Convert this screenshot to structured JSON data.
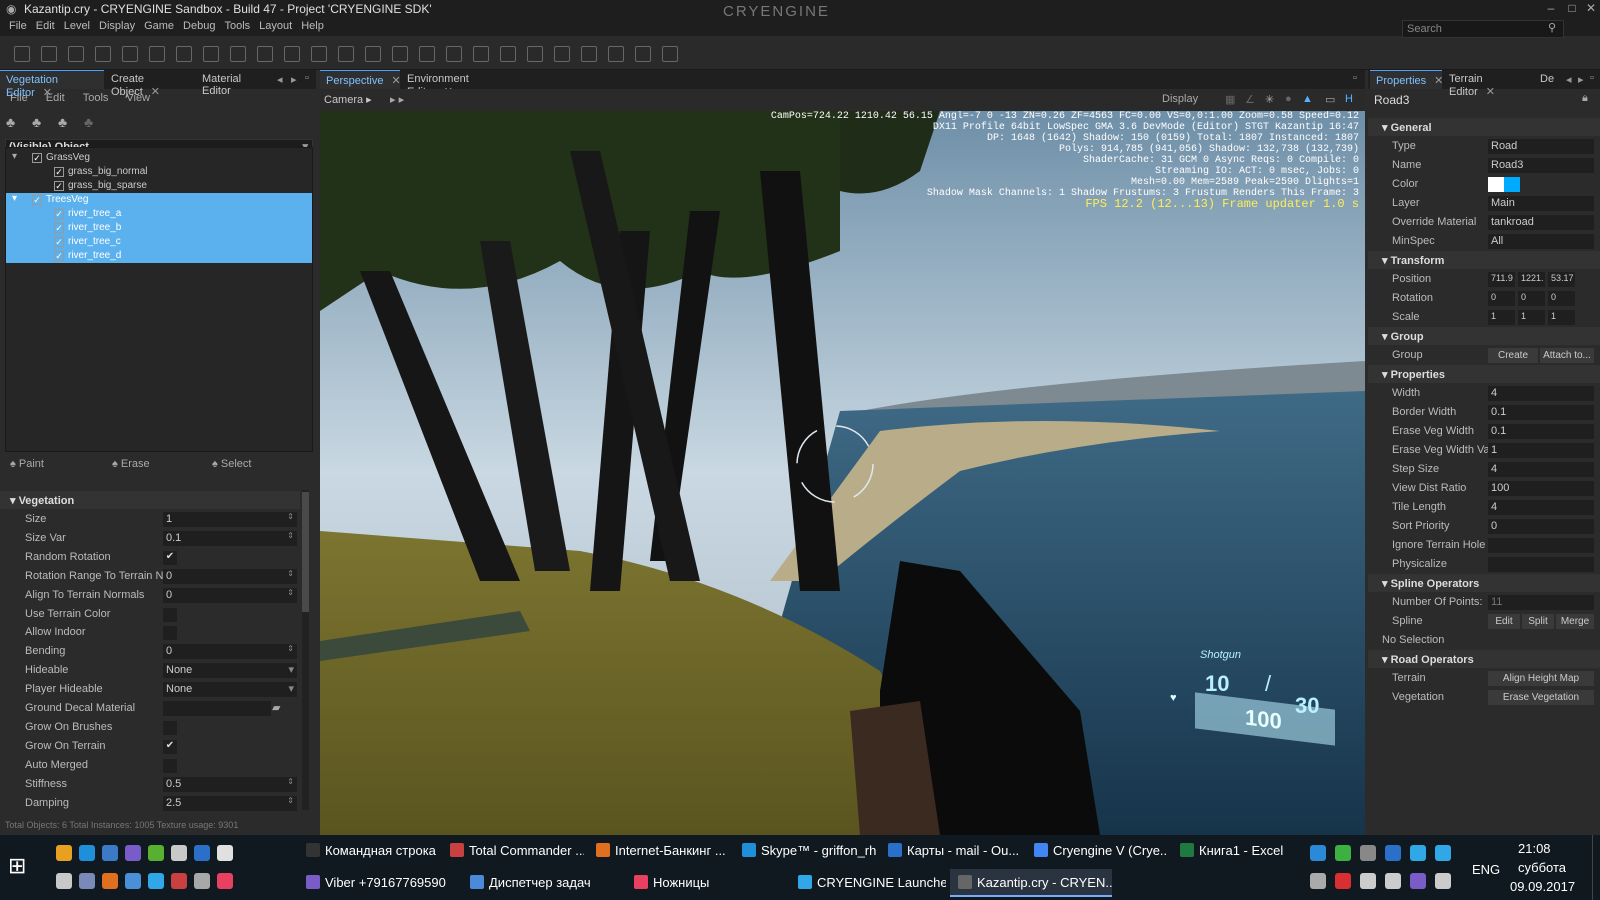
{
  "window": {
    "title": "Kazantip.cry - CRYENGINE Sandbox - Build 47 - Project 'CRYENGINE SDK'",
    "logo": "CRYENGINE",
    "min": "–",
    "max": "□",
    "close": "✕"
  },
  "menu": [
    "File",
    "Edit",
    "Level",
    "Display",
    "Game",
    "Debug",
    "Tools",
    "Layout",
    "Help"
  ],
  "search": {
    "placeholder": "Search"
  },
  "left": {
    "tabs": [
      "Vegetation Editor",
      "Create Object",
      "Material Editor"
    ],
    "submenu": [
      "File",
      "Edit",
      "Tools",
      "View"
    ],
    "filter": "(Visible) Object",
    "tree": [
      {
        "label": "GrassVeg",
        "level": 0,
        "sel": false
      },
      {
        "label": "grass_big_normal",
        "level": 1,
        "sel": false
      },
      {
        "label": "grass_big_sparse",
        "level": 1,
        "sel": false
      },
      {
        "label": "TreesVeg",
        "level": 0,
        "sel": true
      },
      {
        "label": "river_tree_a",
        "level": 1,
        "sel": true
      },
      {
        "label": "river_tree_b",
        "level": 1,
        "sel": true
      },
      {
        "label": "river_tree_c",
        "level": 1,
        "sel": true
      },
      {
        "label": "river_tree_d",
        "level": 1,
        "sel": true
      }
    ],
    "actions": [
      "Paint",
      "Erase",
      "Select"
    ],
    "section": "Vegetation",
    "props": [
      {
        "l": "Size",
        "v": "1",
        "t": "num"
      },
      {
        "l": "Size Var",
        "v": "0.1",
        "t": "num"
      },
      {
        "l": "Random Rotation",
        "v": "✔",
        "t": "chk"
      },
      {
        "l": "Rotation Range To Terrain N",
        "v": "0",
        "t": "num"
      },
      {
        "l": "Align To Terrain Normals",
        "v": "0",
        "t": "num"
      },
      {
        "l": "Use Terrain Color",
        "v": "",
        "t": "chk"
      },
      {
        "l": "Allow Indoor",
        "v": "",
        "t": "chk"
      },
      {
        "l": "Bending",
        "v": "0",
        "t": "num"
      },
      {
        "l": "Hideable",
        "v": "None",
        "t": "sel"
      },
      {
        "l": "Player Hideable",
        "v": "None",
        "t": "sel"
      },
      {
        "l": "Ground Decal Material",
        "v": "",
        "t": "file"
      },
      {
        "l": "Grow On Brushes",
        "v": "",
        "t": "chk"
      },
      {
        "l": "Grow On Terrain",
        "v": "✔",
        "t": "chk"
      },
      {
        "l": "Auto Merged",
        "v": "",
        "t": "chk"
      },
      {
        "l": "Stiffness",
        "v": "0.5",
        "t": "num"
      },
      {
        "l": "Damping",
        "v": "2.5",
        "t": "num"
      }
    ],
    "status": "Total Objects: 6  Total Instances: 1005  Texture usage: 9301"
  },
  "viewport": {
    "tabs": [
      "Perspective",
      "Environment Editor"
    ],
    "camera": "Camera",
    "display": "Display",
    "hud": [
      "CamPos=724.22 1210.42 56.15 Angl=-7  0  -13 ZN=0.26 ZF=4563 FC=0.00 VS=0,0:1.00 Zoom=0.58 Speed=0.12",
      "DX11 Profile 64bit LowSpec GMA 3.6 DevMode (Editor) STGT Kazantip 16:47",
      "DP: 1648 (1642) Shadow: 150 (0159) Total: 1807 Instanced: 1807",
      "Polys: 914,785 (941,056) Shadow: 132,738 (132,739)",
      "ShaderCache: 31 GCM 0 Async Reqs: 0 Compile: 0",
      "Streaming IO: ACT: 0 msec, Jobs: 0",
      "Mesh=0.00 Mem=2589 Peak=2590 Dlights=1",
      "Shadow Mask Channels: 1 Shadow Frustums: 3 Frustum Renders This Frame: 3",
      "FPS 12.2 (12...13) Frame updater 1.0 s"
    ],
    "weapon": "Shotgun",
    "ammo": "10",
    "ammo_total": "30",
    "health": "100"
  },
  "right": {
    "tabs": [
      "Properties",
      "Terrain Editor",
      "De"
    ],
    "object": "Road3",
    "sections": {
      "general": "General",
      "transform": "Transform",
      "group": "Group",
      "properties": "Properties",
      "spline": "Spline Operators",
      "road": "Road Operators"
    },
    "general": [
      {
        "l": "Type",
        "v": "Road"
      },
      {
        "l": "Name",
        "v": "Road3"
      },
      {
        "l": "Color",
        "v": ""
      },
      {
        "l": "Layer",
        "v": "Main"
      },
      {
        "l": "Override Material",
        "v": "tankroad"
      },
      {
        "l": "MinSpec",
        "v": "All"
      }
    ],
    "transform": [
      {
        "l": "Position",
        "v": [
          "711.9",
          "1221.",
          "53.17"
        ]
      },
      {
        "l": "Rotation",
        "v": [
          "0",
          "0",
          "0"
        ]
      },
      {
        "l": "Scale",
        "v": [
          "1",
          "1",
          "1"
        ]
      }
    ],
    "group": {
      "l": "Group",
      "create": "Create",
      "attach": "Attach to..."
    },
    "props": [
      {
        "l": "Width",
        "v": "4"
      },
      {
        "l": "Border Width",
        "v": "0.1"
      },
      {
        "l": "Erase Veg Width",
        "v": "0.1"
      },
      {
        "l": "Erase Veg Width Va",
        "v": "1"
      },
      {
        "l": "Step Size",
        "v": "4"
      },
      {
        "l": "View Dist Ratio",
        "v": "100"
      },
      {
        "l": "Tile Length",
        "v": "4"
      },
      {
        "l": "Sort Priority",
        "v": "0"
      },
      {
        "l": "Ignore Terrain Hole",
        "v": ""
      },
      {
        "l": "Physicalize",
        "v": ""
      }
    ],
    "spline": {
      "points_l": "Number Of Points:",
      "points_v": "11",
      "spline_l": "Spline",
      "edit": "Edit",
      "split": "Split",
      "merge": "Merge",
      "nosel": "No Selection"
    },
    "road": {
      "terrain_l": "Terrain",
      "terrain_b": "Align Height Map",
      "veg_l": "Vegetation",
      "veg_b": "Erase Vegetation"
    }
  },
  "taskbar": {
    "row1": [
      "Командная строка",
      "Total Commander ...",
      "Internet-Банкинг ...",
      "Skype™ - griffon_rh",
      "Карты - mail - Ou...",
      "Cryengine V (Crye...",
      "Книга1 - Excel"
    ],
    "row2": [
      "Viber +79167769590",
      "Диспетчер задач",
      "Ножницы",
      "CRYENGINE Launcher",
      "Kazantip.cry - CRYEN..."
    ],
    "lang": "ENG",
    "time": "21:08",
    "day": "суббота",
    "date": "09.09.2017"
  },
  "colors": {
    "accent": "#4aa3ff",
    "selection": "#5bb0ee",
    "taskbar": "#101820"
  }
}
